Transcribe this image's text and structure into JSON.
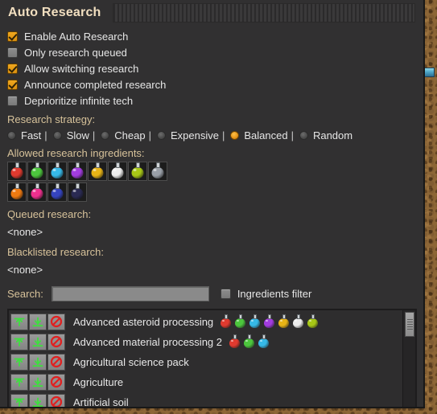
{
  "window": {
    "title": "Auto Research"
  },
  "options": [
    {
      "label": "Enable Auto Research",
      "checked": true
    },
    {
      "label": "Only research queued",
      "checked": false
    },
    {
      "label": "Allow switching research",
      "checked": true
    },
    {
      "label": "Announce completed research",
      "checked": true
    },
    {
      "label": "Deprioritize infinite tech",
      "checked": false
    }
  ],
  "strategy": {
    "heading": "Research strategy:",
    "separator": "|",
    "selected": "Balanced",
    "options": [
      {
        "label": "Fast",
        "selected": false
      },
      {
        "label": "Slow",
        "selected": false
      },
      {
        "label": "Cheap",
        "selected": false
      },
      {
        "label": "Expensive",
        "selected": false
      },
      {
        "label": "Balanced",
        "selected": true
      },
      {
        "label": "Random",
        "selected": false
      }
    ]
  },
  "ingredients": {
    "heading": "Allowed research ingredients:",
    "packs": [
      {
        "name": "automation-science-pack",
        "color": "#e03a2f"
      },
      {
        "name": "logistic-science-pack",
        "color": "#4cc63d"
      },
      {
        "name": "chemical-science-pack",
        "color": "#36b9e8"
      },
      {
        "name": "military-science-pack",
        "color": "#a33ce0"
      },
      {
        "name": "production-science-pack",
        "color": "#e8b416"
      },
      {
        "name": "utility-science-pack",
        "color": "#ededed"
      },
      {
        "name": "agricultural-science-pack",
        "color": "#a8c816"
      },
      {
        "name": "metallurgic-science-pack",
        "color": "#9aa0a8"
      },
      {
        "name": "electromagnetic-science-pack",
        "color": "#f07a10"
      },
      {
        "name": "cryogenic-science-pack",
        "color": "#ef2f8e"
      },
      {
        "name": "promethium-science-pack",
        "color": "#3544c0"
      },
      {
        "name": "space-science-pack",
        "color": "#2a2a52"
      }
    ]
  },
  "queued": {
    "heading": "Queued research:",
    "value": "<none>"
  },
  "blacklisted": {
    "heading": "Blacklisted research:",
    "value": "<none>"
  },
  "search": {
    "label": "Search:",
    "value": "",
    "placeholder": "",
    "filter_label": "Ingredients filter",
    "filter_checked": false
  },
  "tech_list": {
    "row_buttons": [
      {
        "name": "queue-top-button",
        "title": "Add to top of queue"
      },
      {
        "name": "queue-bottom-button",
        "title": "Add to bottom of queue"
      },
      {
        "name": "blacklist-button",
        "title": "Blacklist"
      }
    ],
    "rows": [
      {
        "name": "Advanced asteroid processing",
        "packs": [
          "#e03a2f",
          "#4cc63d",
          "#36b9e8",
          "#a33ce0",
          "#e8b416",
          "#ededed",
          "#a8c816"
        ]
      },
      {
        "name": "Advanced material processing 2",
        "packs": [
          "#e03a2f",
          "#4cc63d",
          "#36b9e8"
        ]
      },
      {
        "name": "Agricultural science pack",
        "packs": []
      },
      {
        "name": "Agriculture",
        "packs": []
      },
      {
        "name": "Artificial soil",
        "packs": []
      }
    ]
  },
  "colors": {
    "accent": "#e8971a",
    "title_text": "#f2dfc0",
    "section_text": "#d7c29a",
    "body_text": "#e6e6e6",
    "window_bg": "#313031",
    "add_icon": "#3ee03e",
    "block_icon": "#e02020"
  }
}
